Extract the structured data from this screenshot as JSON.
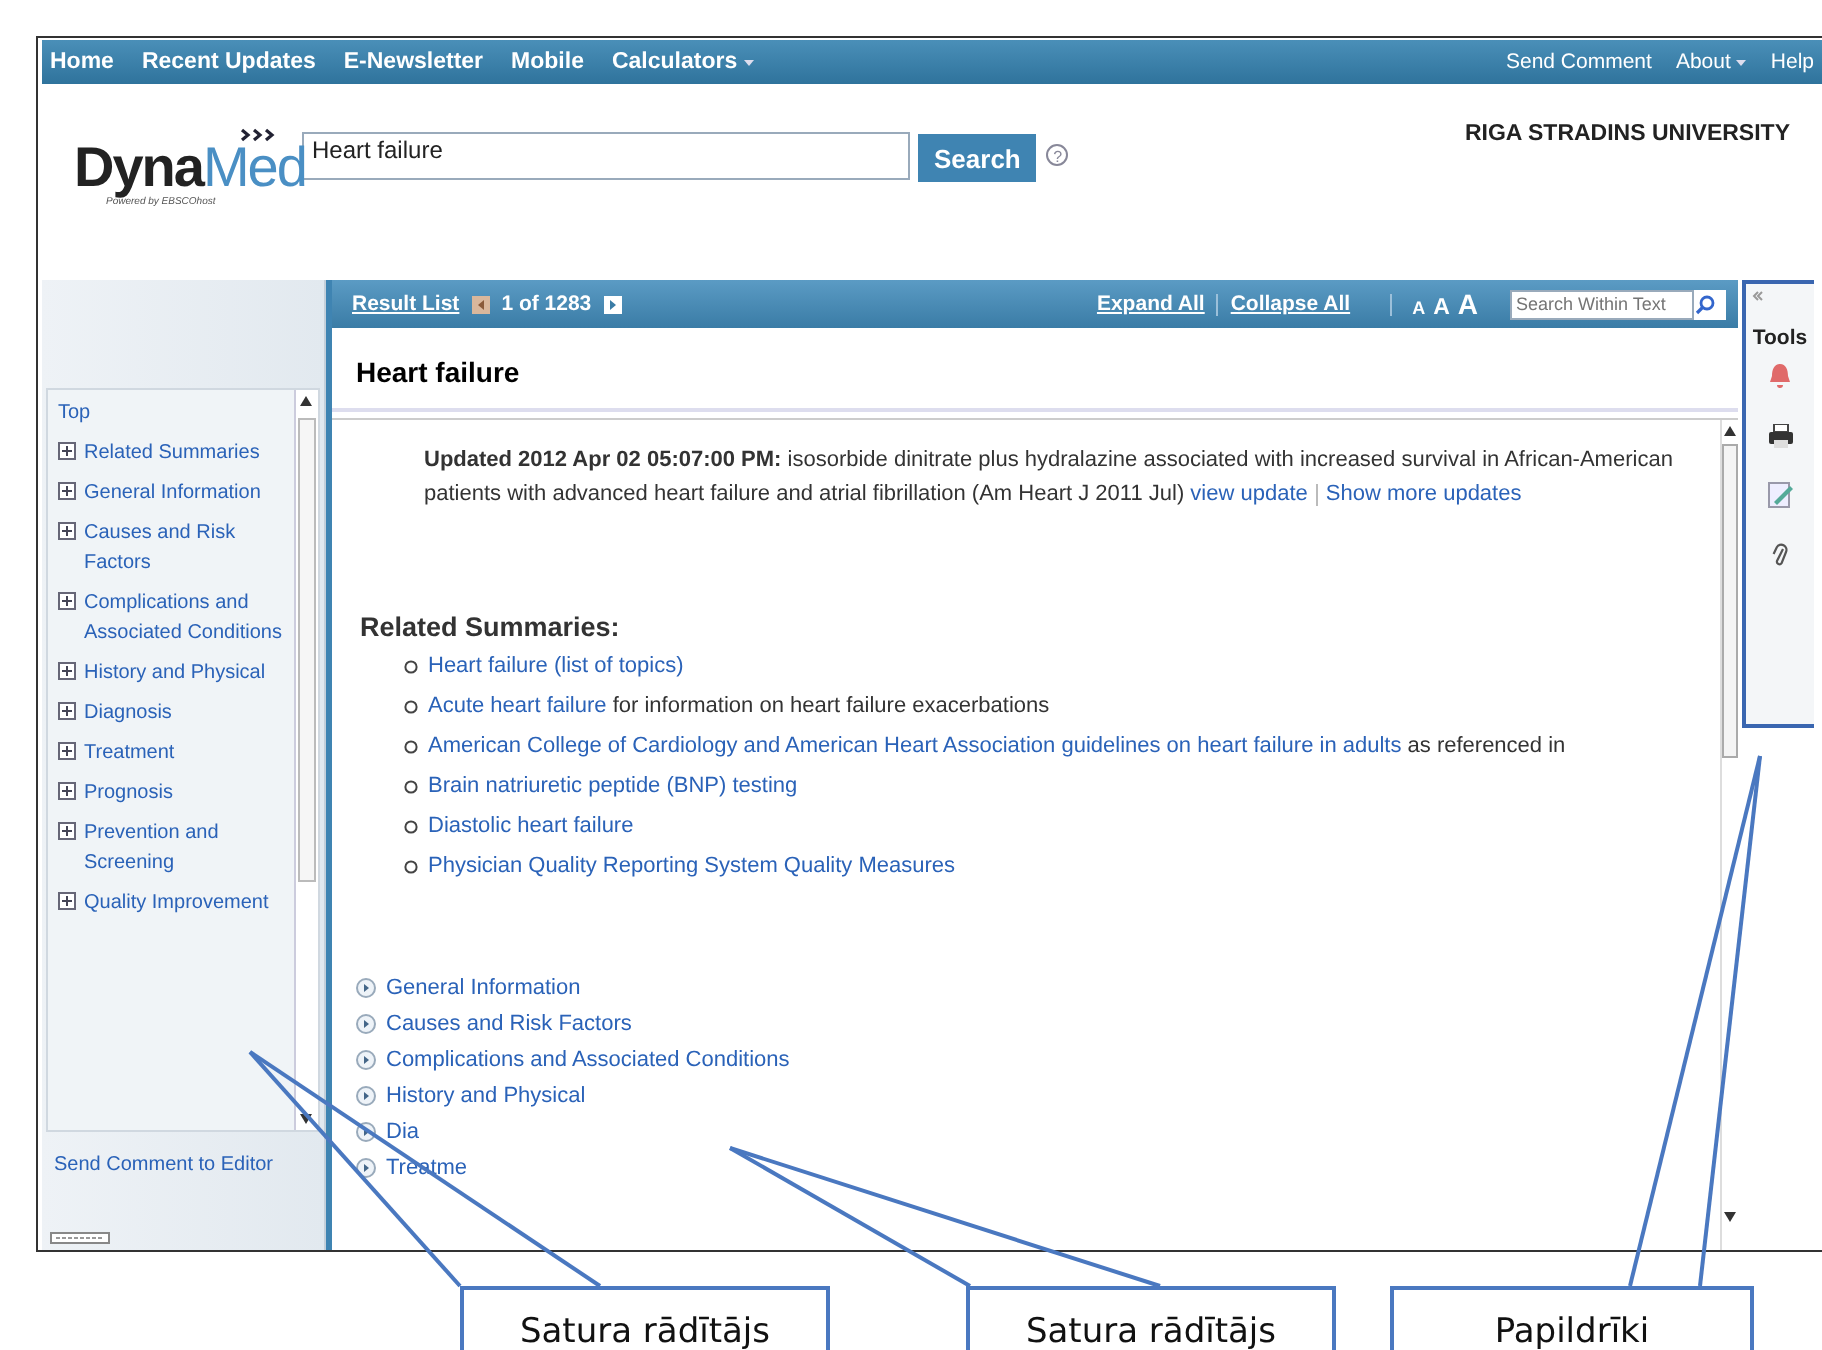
{
  "nav": {
    "left": [
      {
        "label": "Home",
        "caret": false
      },
      {
        "label": "Recent Updates",
        "caret": false
      },
      {
        "label": "E-Newsletter",
        "caret": false
      },
      {
        "label": "Mobile",
        "caret": false
      },
      {
        "label": "Calculators",
        "caret": true
      }
    ],
    "right": [
      {
        "label": "Send Comment",
        "caret": false
      },
      {
        "label": "About",
        "caret": true
      },
      {
        "label": "Help",
        "caret": false
      }
    ]
  },
  "header": {
    "logo": {
      "dyna": "Dyna",
      "med": "Med",
      "tagline": "Powered by EBSCOhost"
    },
    "search": {
      "value": "Heart failure",
      "button": "Search",
      "help": "?"
    },
    "institution": "RIGA STRADINS UNIVERSITY"
  },
  "sidebar": {
    "top": "Top",
    "items": [
      "Related Summaries",
      "General Information",
      "Causes and Risk Factors",
      "Complications and Associated Conditions",
      "History and Physical",
      "Diagnosis",
      "Treatment",
      "Prognosis",
      "Prevention and Screening",
      "Quality Improvement"
    ],
    "footer": "Send Comment to Editor"
  },
  "toolbar": {
    "result_list": "Result List",
    "position": "1 of 1283",
    "expand": "Expand All",
    "collapse": "Collapse All",
    "font_sizes": [
      "A",
      "A",
      "A"
    ],
    "search_placeholder": "Search Within Text"
  },
  "article": {
    "title": "Heart failure",
    "update": {
      "label": "Updated 2012 Apr 02 05:07:00 PM:",
      "text": " isosorbide dinitrate plus hydralazine associated with increased survival in African-American patients with advanced heart failure and atrial fibrillation (Am Heart J 2011 Jul) ",
      "links": [
        "view update",
        "Show more updates"
      ]
    },
    "related_heading": "Related Summaries:",
    "related": [
      {
        "link": "Heart failure (list of topics)"
      },
      {
        "link": "Acute heart failure",
        "rest": " for information on heart failure exacerbations"
      },
      {
        "link": "American College of Cardiology and American Heart Association guidelines on heart failure in adults",
        "rest": " as referenced in"
      },
      {
        "link": "Brain natriuretic peptide (BNP) testing"
      },
      {
        "link": "Diastolic heart failure"
      },
      {
        "link": "Physician Quality Reporting System Quality Measures"
      }
    ],
    "sections": [
      "General Information",
      "Causes and Risk Factors",
      "Complications and Associated Conditions",
      "History and Physical",
      "Dia",
      "Treatme"
    ]
  },
  "tools": {
    "title": "Tools"
  },
  "callouts": [
    "Satura rādītājs",
    "Satura rādītājs",
    "Papildrīki"
  ]
}
